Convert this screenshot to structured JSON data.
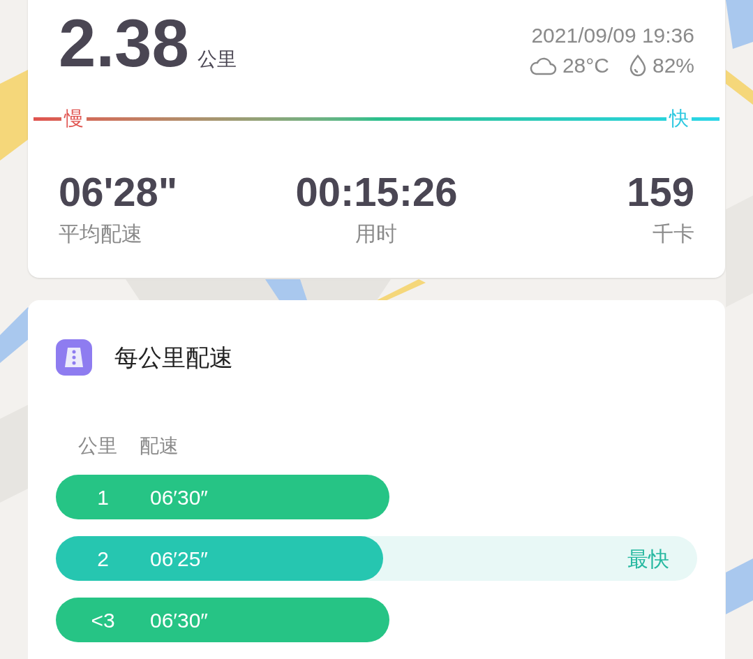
{
  "summary": {
    "distance": "2.38",
    "distance_unit": "公里",
    "datetime": "2021/09/09 19:36",
    "temperature": "28°C",
    "humidity": "82%"
  },
  "speed_scale": {
    "slow_label": "慢",
    "fast_label": "快"
  },
  "stats": [
    {
      "value": "06'28\"",
      "label": "平均配速"
    },
    {
      "value": "00:15:26",
      "label": "用时"
    },
    {
      "value": "159",
      "label": "千卡"
    }
  ],
  "pace_card": {
    "title": "每公里配速",
    "columns": [
      "公里",
      "配速"
    ],
    "rows": [
      {
        "km": "1",
        "pace": "06′30″",
        "fastest": false
      },
      {
        "km": "2",
        "pace": "06′25″",
        "level": 0.51,
        "fastest": true,
        "tag": "最快"
      },
      {
        "km": "<3",
        "pace": "06′30″",
        "fastest": false
      }
    ]
  }
}
